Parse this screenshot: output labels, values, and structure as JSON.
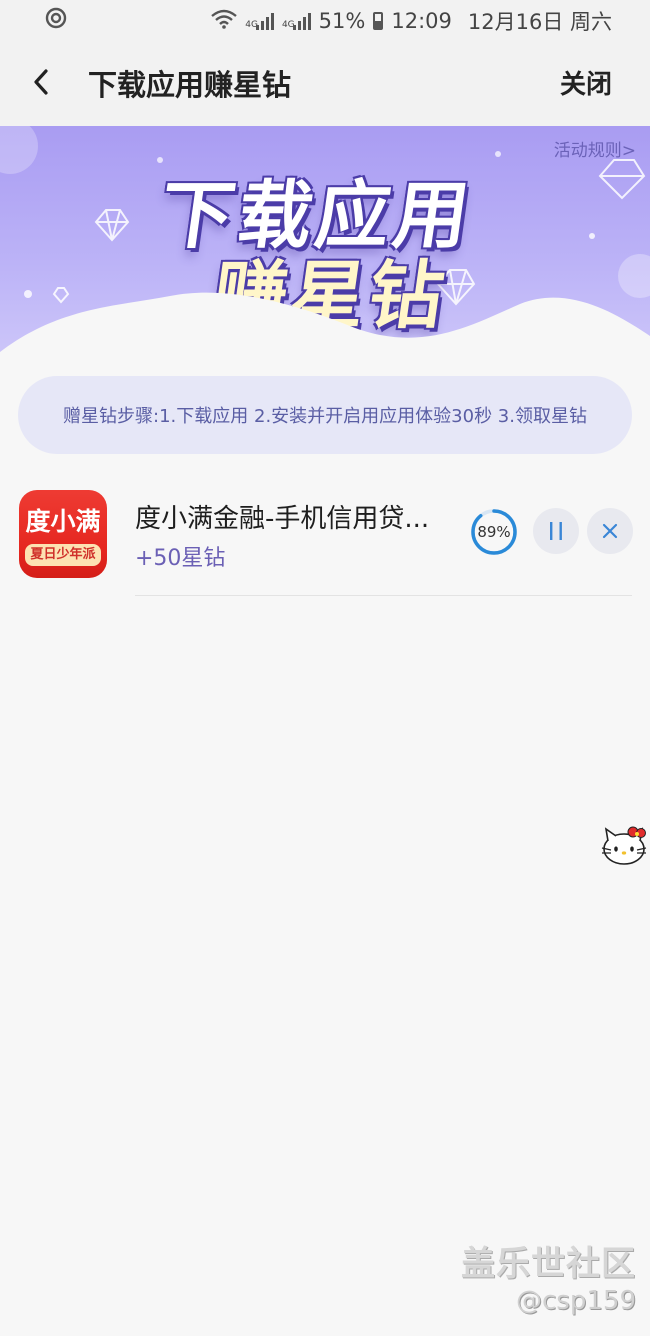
{
  "status_bar": {
    "battery": "51%",
    "time": "12:09",
    "date": "12月16日 周六",
    "network_1": "4G",
    "network_2": "4G"
  },
  "header": {
    "title": "下载应用赚星钻",
    "close_label": "关闭"
  },
  "banner": {
    "line1": "下载应用",
    "line2": "赚星钻",
    "rules_link": "活动规则>"
  },
  "steps": {
    "text": "赠星钻步骤:1.下载应用 2.安装并开启用应用体验30秒 3.领取星钻"
  },
  "apps": [
    {
      "icon_text": "度小满",
      "icon_tag": "夏日少年派",
      "name": "度小满金融-手机信用贷...",
      "reward": "+50星钻",
      "progress_label": "89%",
      "progress": 0.89
    }
  ],
  "watermark": {
    "line1": "盖乐世社区",
    "line2": "@csp159"
  },
  "colors": {
    "banner_purple": "#a99cf2",
    "reward_purple": "#6b60b5",
    "progress_blue": "#2a8ad8",
    "app_red": "#e5261f"
  }
}
